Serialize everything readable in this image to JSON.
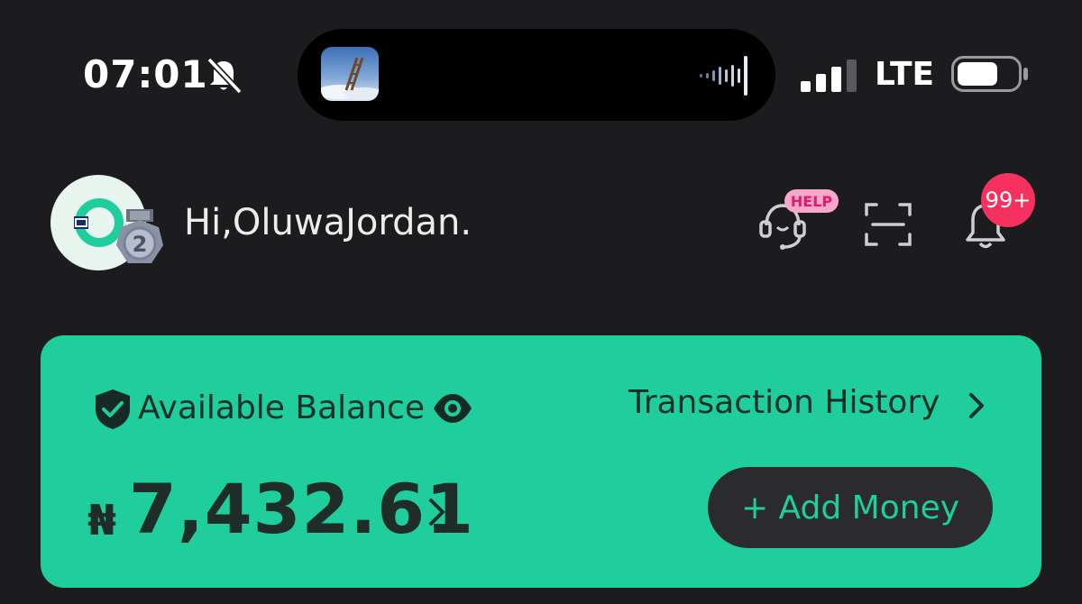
{
  "status_bar": {
    "time": "07:01",
    "network": "LTE"
  },
  "header": {
    "greeting": "Hi,OluwaJordan.",
    "help_badge": "HELP",
    "notification_count": "99+",
    "medal_level": "2"
  },
  "balance_card": {
    "label": "Available Balance",
    "transaction_history": "Transaction History",
    "currency_symbol": "₦",
    "amount": "7,432.61",
    "add_money": "+ Add Money"
  },
  "colors": {
    "background": "#1c1c1e",
    "accent_green": "#1fce9c",
    "badge_red": "#f5315f",
    "help_pink": "#f7a8c8"
  },
  "icons": [
    "bell-off-icon",
    "signal-icon",
    "battery-icon",
    "medal-icon",
    "headset-icon",
    "scan-icon",
    "bell-icon",
    "shield-check-icon",
    "eye-icon",
    "chevron-right-icon"
  ]
}
